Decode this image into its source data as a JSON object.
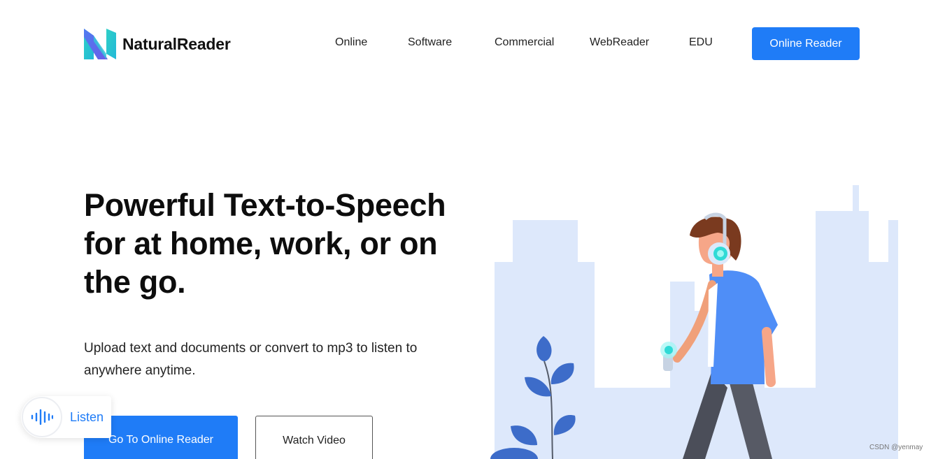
{
  "brand": {
    "name": "NaturalReader"
  },
  "nav": {
    "items": [
      {
        "label": "Online"
      },
      {
        "label": "Software"
      },
      {
        "label": "Commercial"
      },
      {
        "label": "WebReader"
      },
      {
        "label": "EDU"
      }
    ],
    "cta_label": "Online Reader"
  },
  "hero": {
    "title": "Powerful Text-to-Speech for at home, work, or on the go.",
    "subtitle": "Upload text and documents or convert to mp3 to listen to anywhere anytime.",
    "primary_button": "Go To Online Reader",
    "secondary_button": "Watch Video"
  },
  "listen_widget": {
    "label": "Listen",
    "icon": "audio-wave-icon"
  },
  "illustration": {
    "description_icon": "person-with-headphones-illustration"
  },
  "watermark": "CSDN @yenmay",
  "colors": {
    "accent": "#1f7cf7",
    "city": "#dde8fb",
    "plant": "#3d6cc9"
  }
}
